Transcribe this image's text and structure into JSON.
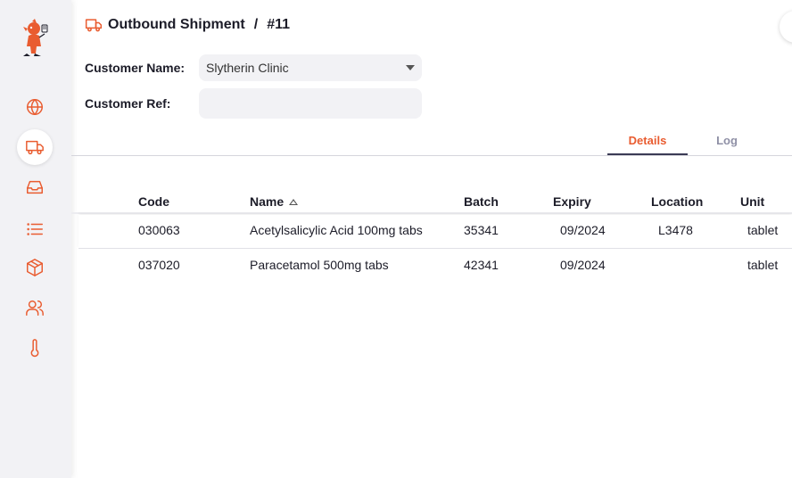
{
  "header": {
    "title": "Outbound Shipment",
    "separator": "/",
    "number": "#11",
    "icon": "truck-icon"
  },
  "form": {
    "customer_name_label": "Customer Name:",
    "customer_name_value": "Slytherin Clinic",
    "customer_ref_label": "Customer Ref:",
    "customer_ref_value": ""
  },
  "tabs": [
    {
      "label": "Details",
      "active": true
    },
    {
      "label": "Log",
      "active": false
    }
  ],
  "table": {
    "columns": [
      "Code",
      "Name",
      "Batch",
      "Expiry",
      "Location",
      "Unit"
    ],
    "sorted_column": "Name",
    "rows": [
      {
        "code": "030063",
        "name": "Acetylsalicylic Acid 100mg tabs",
        "batch": "35341",
        "expiry": "09/2024",
        "location": "L3478",
        "unit": "tablet"
      },
      {
        "code": "037020",
        "name": "Paracetamol 500mg tabs",
        "batch": "42341",
        "expiry": "09/2024",
        "location": "",
        "unit": "tablet"
      }
    ]
  },
  "sidebar": {
    "items": [
      {
        "icon": "globe-icon",
        "active": false
      },
      {
        "icon": "truck-icon",
        "active": true
      },
      {
        "icon": "inbox-icon",
        "active": false
      },
      {
        "icon": "list-icon",
        "active": false
      },
      {
        "icon": "package-icon",
        "active": false
      },
      {
        "icon": "users-icon",
        "active": false
      },
      {
        "icon": "thermometer-icon",
        "active": false
      }
    ]
  },
  "colors": {
    "accent": "#e95c30",
    "sidebar_bg": "#f2f2f5",
    "tab_indicator": "#3b3b55"
  }
}
